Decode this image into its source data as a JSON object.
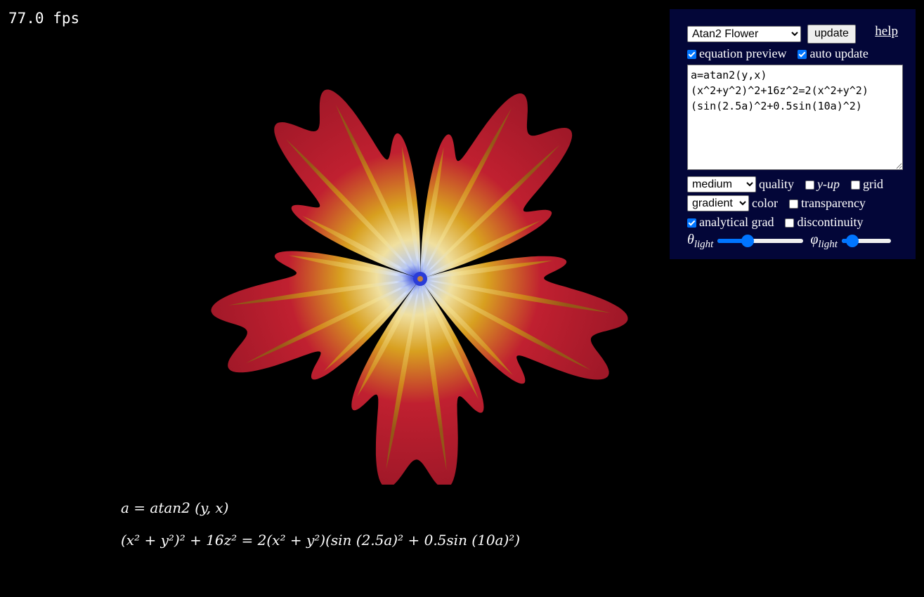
{
  "fps": "77.0 fps",
  "panel": {
    "preset_selected": "Atan2 Flower",
    "update_label": "update",
    "help_label": "help",
    "equation_preview_label": "equation preview",
    "equation_preview_checked": true,
    "auto_update_label": "auto update",
    "auto_update_checked": true,
    "equation_text": "a=atan2(y,x)\n(x^2+y^2)^2+16z^2=2(x^2+y^2)(sin(2.5a)^2+0.5sin(10a)^2)",
    "quality_selected": "medium",
    "quality_label": "quality",
    "y_up_label": "y-up",
    "y_up_checked": false,
    "grid_label": "grid",
    "grid_checked": false,
    "color_selected": "gradient",
    "color_label": "color",
    "transparency_label": "transparency",
    "transparency_checked": false,
    "analytical_grad_label": "analytical grad",
    "analytical_grad_checked": true,
    "discontinuity_label": "discontinuity",
    "discontinuity_checked": false,
    "theta_symbol": "θ",
    "phi_symbol": "φ",
    "light_subscript": "light",
    "theta_light_value": 0.35,
    "phi_light_value": 0.22
  },
  "preview": {
    "line1": "a = atan2 (y, x)",
    "line2": "(x² + y²)² + 16z² = 2(x² + y²)(sin (2.5a)² + 0.5sin (10a)²)"
  },
  "colors": {
    "background": "#000000",
    "panel": "#030638",
    "accent": "#0075ff",
    "petal_red": "#c0182c",
    "petal_gold": "#e0b020",
    "center_blue": "#2040d0"
  }
}
